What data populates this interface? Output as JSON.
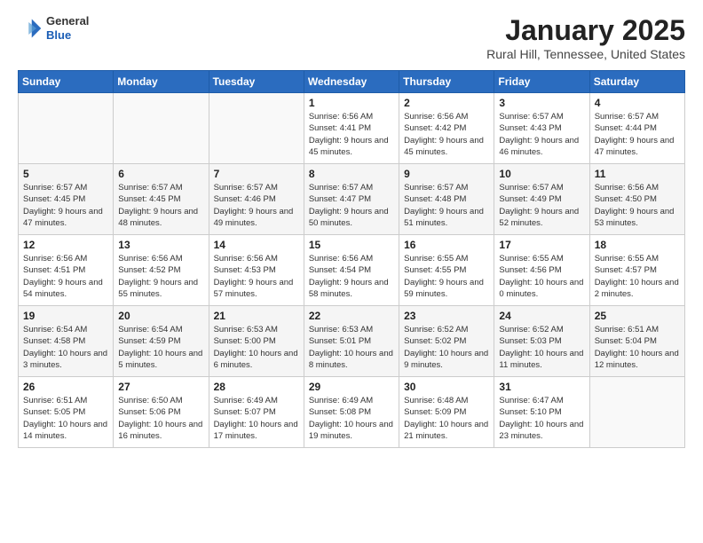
{
  "header": {
    "logo": {
      "general": "General",
      "blue": "Blue"
    },
    "title": "January 2025",
    "location": "Rural Hill, Tennessee, United States"
  },
  "days_of_week": [
    "Sunday",
    "Monday",
    "Tuesday",
    "Wednesday",
    "Thursday",
    "Friday",
    "Saturday"
  ],
  "weeks": [
    [
      {
        "day": "",
        "info": ""
      },
      {
        "day": "",
        "info": ""
      },
      {
        "day": "",
        "info": ""
      },
      {
        "day": "1",
        "info": "Sunrise: 6:56 AM\nSunset: 4:41 PM\nDaylight: 9 hours\nand 45 minutes."
      },
      {
        "day": "2",
        "info": "Sunrise: 6:56 AM\nSunset: 4:42 PM\nDaylight: 9 hours\nand 45 minutes."
      },
      {
        "day": "3",
        "info": "Sunrise: 6:57 AM\nSunset: 4:43 PM\nDaylight: 9 hours\nand 46 minutes."
      },
      {
        "day": "4",
        "info": "Sunrise: 6:57 AM\nSunset: 4:44 PM\nDaylight: 9 hours\nand 47 minutes."
      }
    ],
    [
      {
        "day": "5",
        "info": "Sunrise: 6:57 AM\nSunset: 4:45 PM\nDaylight: 9 hours\nand 47 minutes."
      },
      {
        "day": "6",
        "info": "Sunrise: 6:57 AM\nSunset: 4:45 PM\nDaylight: 9 hours\nand 48 minutes."
      },
      {
        "day": "7",
        "info": "Sunrise: 6:57 AM\nSunset: 4:46 PM\nDaylight: 9 hours\nand 49 minutes."
      },
      {
        "day": "8",
        "info": "Sunrise: 6:57 AM\nSunset: 4:47 PM\nDaylight: 9 hours\nand 50 minutes."
      },
      {
        "day": "9",
        "info": "Sunrise: 6:57 AM\nSunset: 4:48 PM\nDaylight: 9 hours\nand 51 minutes."
      },
      {
        "day": "10",
        "info": "Sunrise: 6:57 AM\nSunset: 4:49 PM\nDaylight: 9 hours\nand 52 minutes."
      },
      {
        "day": "11",
        "info": "Sunrise: 6:56 AM\nSunset: 4:50 PM\nDaylight: 9 hours\nand 53 minutes."
      }
    ],
    [
      {
        "day": "12",
        "info": "Sunrise: 6:56 AM\nSunset: 4:51 PM\nDaylight: 9 hours\nand 54 minutes."
      },
      {
        "day": "13",
        "info": "Sunrise: 6:56 AM\nSunset: 4:52 PM\nDaylight: 9 hours\nand 55 minutes."
      },
      {
        "day": "14",
        "info": "Sunrise: 6:56 AM\nSunset: 4:53 PM\nDaylight: 9 hours\nand 57 minutes."
      },
      {
        "day": "15",
        "info": "Sunrise: 6:56 AM\nSunset: 4:54 PM\nDaylight: 9 hours\nand 58 minutes."
      },
      {
        "day": "16",
        "info": "Sunrise: 6:55 AM\nSunset: 4:55 PM\nDaylight: 9 hours\nand 59 minutes."
      },
      {
        "day": "17",
        "info": "Sunrise: 6:55 AM\nSunset: 4:56 PM\nDaylight: 10 hours\nand 0 minutes."
      },
      {
        "day": "18",
        "info": "Sunrise: 6:55 AM\nSunset: 4:57 PM\nDaylight: 10 hours\nand 2 minutes."
      }
    ],
    [
      {
        "day": "19",
        "info": "Sunrise: 6:54 AM\nSunset: 4:58 PM\nDaylight: 10 hours\nand 3 minutes."
      },
      {
        "day": "20",
        "info": "Sunrise: 6:54 AM\nSunset: 4:59 PM\nDaylight: 10 hours\nand 5 minutes."
      },
      {
        "day": "21",
        "info": "Sunrise: 6:53 AM\nSunset: 5:00 PM\nDaylight: 10 hours\nand 6 minutes."
      },
      {
        "day": "22",
        "info": "Sunrise: 6:53 AM\nSunset: 5:01 PM\nDaylight: 10 hours\nand 8 minutes."
      },
      {
        "day": "23",
        "info": "Sunrise: 6:52 AM\nSunset: 5:02 PM\nDaylight: 10 hours\nand 9 minutes."
      },
      {
        "day": "24",
        "info": "Sunrise: 6:52 AM\nSunset: 5:03 PM\nDaylight: 10 hours\nand 11 minutes."
      },
      {
        "day": "25",
        "info": "Sunrise: 6:51 AM\nSunset: 5:04 PM\nDaylight: 10 hours\nand 12 minutes."
      }
    ],
    [
      {
        "day": "26",
        "info": "Sunrise: 6:51 AM\nSunset: 5:05 PM\nDaylight: 10 hours\nand 14 minutes."
      },
      {
        "day": "27",
        "info": "Sunrise: 6:50 AM\nSunset: 5:06 PM\nDaylight: 10 hours\nand 16 minutes."
      },
      {
        "day": "28",
        "info": "Sunrise: 6:49 AM\nSunset: 5:07 PM\nDaylight: 10 hours\nand 17 minutes."
      },
      {
        "day": "29",
        "info": "Sunrise: 6:49 AM\nSunset: 5:08 PM\nDaylight: 10 hours\nand 19 minutes."
      },
      {
        "day": "30",
        "info": "Sunrise: 6:48 AM\nSunset: 5:09 PM\nDaylight: 10 hours\nand 21 minutes."
      },
      {
        "day": "31",
        "info": "Sunrise: 6:47 AM\nSunset: 5:10 PM\nDaylight: 10 hours\nand 23 minutes."
      },
      {
        "day": "",
        "info": ""
      }
    ]
  ]
}
